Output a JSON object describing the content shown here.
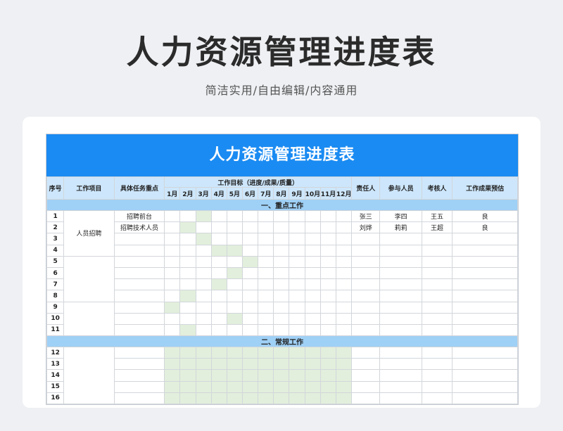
{
  "header": {
    "title": "人力资源管理进度表",
    "subtitle": "简洁实用/自由编辑/内容通用"
  },
  "sheet": {
    "title": "人力资源管理进度表",
    "columns": {
      "index": "序号",
      "project": "工作项目",
      "task": "具体任务重点",
      "goal": "工作目标（进度/成果/质量）",
      "months": [
        "1月",
        "2月",
        "3月",
        "4月",
        "5月",
        "6月",
        "7月",
        "8月",
        "9月",
        "10月",
        "11月",
        "12月"
      ],
      "owner": "责任人",
      "members": "参与人员",
      "reviewer": "考核人",
      "estimate": "工作成果预估"
    },
    "sections": [
      {
        "name": "一、重点工作",
        "groups": [
          {
            "project": "人员招聘",
            "rows": [
              {
                "no": "1",
                "task": "招聘前台",
                "months": [
                  0,
                  0,
                  1,
                  0,
                  0,
                  0,
                  0,
                  0,
                  0,
                  0,
                  0,
                  0
                ],
                "owner": "张三",
                "members": "李四",
                "reviewer": "王五",
                "estimate": "良"
              },
              {
                "no": "2",
                "task": "招聘技术人员",
                "months": [
                  0,
                  1,
                  0,
                  0,
                  0,
                  0,
                  0,
                  0,
                  0,
                  0,
                  0,
                  0
                ],
                "owner": "刘烨",
                "members": "莉莉",
                "reviewer": "王超",
                "estimate": "良"
              },
              {
                "no": "3",
                "task": "",
                "months": [
                  0,
                  0,
                  1,
                  0,
                  0,
                  0,
                  0,
                  0,
                  0,
                  0,
                  0,
                  0
                ],
                "owner": "",
                "members": "",
                "reviewer": "",
                "estimate": ""
              },
              {
                "no": "4",
                "task": "",
                "months": [
                  0,
                  0,
                  0,
                  1,
                  1,
                  0,
                  0,
                  0,
                  0,
                  0,
                  0,
                  0
                ],
                "owner": "",
                "members": "",
                "reviewer": "",
                "estimate": ""
              }
            ]
          },
          {
            "project": "",
            "rows": [
              {
                "no": "5",
                "task": "",
                "months": [
                  0,
                  0,
                  0,
                  0,
                  0,
                  1,
                  0,
                  0,
                  0,
                  0,
                  0,
                  0
                ],
                "owner": "",
                "members": "",
                "reviewer": "",
                "estimate": ""
              },
              {
                "no": "6",
                "task": "",
                "months": [
                  0,
                  0,
                  0,
                  0,
                  1,
                  0,
                  0,
                  0,
                  0,
                  0,
                  0,
                  0
                ],
                "owner": "",
                "members": "",
                "reviewer": "",
                "estimate": ""
              },
              {
                "no": "7",
                "task": "",
                "months": [
                  0,
                  0,
                  0,
                  1,
                  0,
                  0,
                  0,
                  0,
                  0,
                  0,
                  0,
                  0
                ],
                "owner": "",
                "members": "",
                "reviewer": "",
                "estimate": ""
              },
              {
                "no": "8",
                "task": "",
                "months": [
                  0,
                  1,
                  0,
                  0,
                  0,
                  0,
                  0,
                  0,
                  0,
                  0,
                  0,
                  0
                ],
                "owner": "",
                "members": "",
                "reviewer": "",
                "estimate": ""
              }
            ]
          },
          {
            "project": "",
            "rows": [
              {
                "no": "9",
                "task": "",
                "months": [
                  1,
                  0,
                  0,
                  0,
                  0,
                  0,
                  0,
                  0,
                  0,
                  0,
                  0,
                  0
                ],
                "owner": "",
                "members": "",
                "reviewer": "",
                "estimate": ""
              },
              {
                "no": "10",
                "task": "",
                "months": [
                  0,
                  0,
                  0,
                  0,
                  1,
                  0,
                  0,
                  0,
                  0,
                  0,
                  0,
                  0
                ],
                "owner": "",
                "members": "",
                "reviewer": "",
                "estimate": ""
              },
              {
                "no": "11",
                "task": "",
                "months": [
                  0,
                  1,
                  0,
                  0,
                  0,
                  0,
                  0,
                  0,
                  0,
                  0,
                  0,
                  0
                ],
                "owner": "",
                "members": "",
                "reviewer": "",
                "estimate": ""
              }
            ]
          }
        ]
      },
      {
        "name": "二、常规工作",
        "groups": [
          {
            "project": "",
            "rows": [
              {
                "no": "12",
                "task": "",
                "months": [
                  1,
                  1,
                  1,
                  1,
                  1,
                  1,
                  1,
                  1,
                  1,
                  1,
                  1,
                  1
                ],
                "owner": "",
                "members": "",
                "reviewer": "",
                "estimate": ""
              },
              {
                "no": "13",
                "task": "",
                "months": [
                  1,
                  1,
                  1,
                  1,
                  1,
                  1,
                  1,
                  1,
                  1,
                  1,
                  1,
                  1
                ],
                "owner": "",
                "members": "",
                "reviewer": "",
                "estimate": ""
              },
              {
                "no": "14",
                "task": "",
                "months": [
                  1,
                  1,
                  1,
                  1,
                  1,
                  1,
                  1,
                  1,
                  1,
                  1,
                  1,
                  1
                ],
                "owner": "",
                "members": "",
                "reviewer": "",
                "estimate": ""
              },
              {
                "no": "15",
                "task": "",
                "months": [
                  1,
                  1,
                  1,
                  1,
                  1,
                  1,
                  1,
                  1,
                  1,
                  1,
                  1,
                  1
                ],
                "owner": "",
                "members": "",
                "reviewer": "",
                "estimate": ""
              },
              {
                "no": "16",
                "task": "",
                "months": [
                  1,
                  1,
                  1,
                  1,
                  1,
                  1,
                  1,
                  1,
                  1,
                  1,
                  1,
                  1
                ],
                "owner": "",
                "members": "",
                "reviewer": "",
                "estimate": ""
              }
            ]
          }
        ]
      }
    ]
  }
}
